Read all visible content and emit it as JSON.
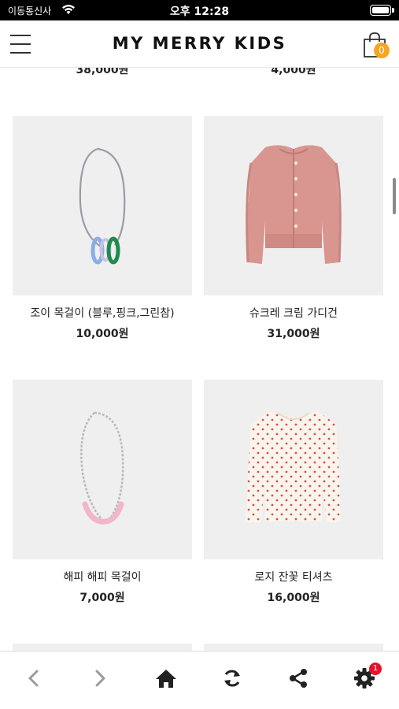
{
  "status_bar": {
    "carrier": "이동통신사",
    "time": "오후 12:28",
    "icons": [
      "wifi-icon",
      "battery-icon"
    ]
  },
  "header": {
    "title": "MY MERRY KIDS",
    "cart_count": "0",
    "icons": [
      "menu-icon",
      "shopping-bag-icon"
    ]
  },
  "partial_row": {
    "prices": [
      "38,000원",
      "4,000원"
    ]
  },
  "products": [
    {
      "name": "조이 목걸이 (블루,핑크,그린참)",
      "price": "10,000원",
      "image": "necklace-with-charms"
    },
    {
      "name": "슈크레 크림 가디건",
      "price": "31,000원",
      "image": "pink-knit-cardigan"
    },
    {
      "name": "해피 해피 목걸이",
      "price": "7,000원",
      "image": "pink-bead-necklace"
    },
    {
      "name": "로지 잔꽃 티셔츠",
      "price": "16,000원",
      "image": "floral-tshirt"
    }
  ],
  "toolbar": {
    "items": [
      "back-icon",
      "forward-icon",
      "home-icon",
      "refresh-icon",
      "share-icon",
      "settings-icon"
    ],
    "settings_badge": "1"
  },
  "colors": {
    "accent_badge": "#f5a623",
    "notification_badge": "#e8112d",
    "image_background": "#efefef"
  }
}
